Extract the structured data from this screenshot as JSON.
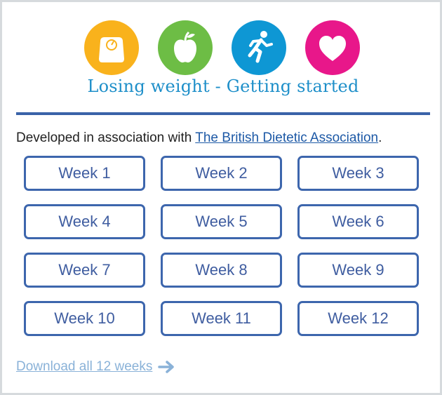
{
  "icons": [
    {
      "name": "scale-icon",
      "color": "#f9b21c"
    },
    {
      "name": "apple-icon",
      "color": "#6dbd45"
    },
    {
      "name": "running-person-icon",
      "color": "#0e97d4"
    },
    {
      "name": "heart-icon",
      "color": "#e8178a"
    }
  ],
  "header": {
    "title": "Losing weight - Getting started"
  },
  "intro": {
    "prefix": "Developed in association with ",
    "link_text": "The British Dietetic Association",
    "suffix": "."
  },
  "weeks": [
    {
      "label": "Week 1"
    },
    {
      "label": "Week 2"
    },
    {
      "label": "Week 3"
    },
    {
      "label": "Week 4"
    },
    {
      "label": "Week 5"
    },
    {
      "label": "Week 6"
    },
    {
      "label": "Week 7"
    },
    {
      "label": "Week 8"
    },
    {
      "label": "Week 9"
    },
    {
      "label": "Week 10"
    },
    {
      "label": "Week 11"
    },
    {
      "label": "Week 12"
    }
  ],
  "footer": {
    "download_label": "Download all 12 weeks"
  },
  "colors": {
    "title": "#1e8fc9",
    "rule": "#3a63a8",
    "button_border": "#3d66ad",
    "button_text": "#3f5da0",
    "link": "#1d59a6",
    "download": "#8ab2d8"
  }
}
